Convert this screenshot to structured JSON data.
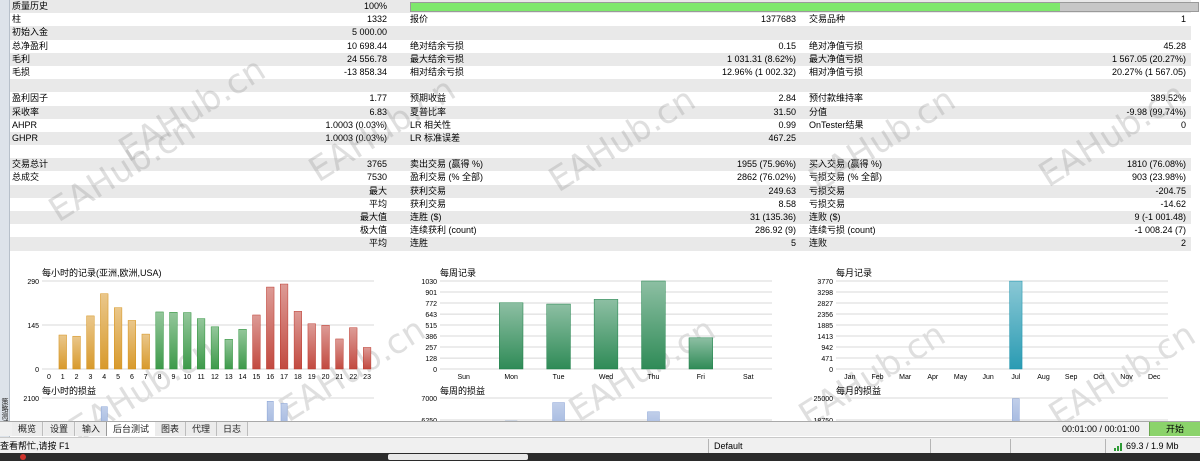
{
  "report": {
    "rows": [
      {
        "shade": true,
        "l1": "质量历史",
        "v1": "100%",
        "l2": "",
        "v2": "",
        "l3": "",
        "v3": ""
      },
      {
        "shade": false,
        "l1": "柱",
        "v1": "1332",
        "l2": "报价",
        "v2": "1377683",
        "l3": "交易品种",
        "v3": "1"
      },
      {
        "shade": true,
        "l1": "初始入金",
        "v1": "5 000.00",
        "l2": "",
        "v2": "",
        "l3": "",
        "v3": ""
      },
      {
        "shade": false,
        "l1": "总净盈利",
        "v1": "10 698.44",
        "l2": "绝对结余亏损",
        "v2": "0.15",
        "l3": "绝对净值亏损",
        "v3": "45.28"
      },
      {
        "shade": true,
        "l1": "毛利",
        "v1": "24 556.78",
        "l2": "最大结余亏损",
        "v2": "1 031.31 (8.62%)",
        "l3": "最大净值亏损",
        "v3": "1 567.05 (20.27%)"
      },
      {
        "shade": false,
        "l1": "毛损",
        "v1": "-13 858.34",
        "l2": "相对结余亏损",
        "v2": "12.96% (1 002.32)",
        "l3": "相对净值亏损",
        "v3": "20.27% (1 567.05)"
      },
      {
        "shade": true,
        "l1": "",
        "v1": "",
        "l2": "",
        "v2": "",
        "l3": "",
        "v3": ""
      },
      {
        "shade": false,
        "l1": "盈利因子",
        "v1": "1.77",
        "l2": "预期收益",
        "v2": "2.84",
        "l3": "预付款维持率",
        "v3": "389.52%"
      },
      {
        "shade": true,
        "l1": "采收率",
        "v1": "6.83",
        "l2": "夏普比率",
        "v2": "31.50",
        "l3": "分值",
        "v3": "-9.98 (99.74%)"
      },
      {
        "shade": false,
        "l1": "AHPR",
        "v1": "1.0003 (0.03%)",
        "l2": "LR 相关性",
        "v2": "0.99",
        "l3": "OnTester结果",
        "v3": "0"
      },
      {
        "shade": true,
        "l1": "GHPR",
        "v1": "1.0003 (0.03%)",
        "l2": "LR 标准误差",
        "v2": "467.25",
        "l3": "",
        "v3": ""
      },
      {
        "shade": false,
        "l1": "",
        "v1": "",
        "l2": "",
        "v2": "",
        "l3": "",
        "v3": ""
      },
      {
        "shade": true,
        "l1": "交易总计",
        "v1": "3765",
        "l2": "卖出交易 (赢得 %)",
        "v2": "1955 (75.96%)",
        "l3": "买入交易 (赢得 %)",
        "v3": "1810 (76.08%)"
      },
      {
        "shade": false,
        "l1": "总成交",
        "v1": "7530",
        "l2": "盈利交易 (% 全部)",
        "v2": "2862 (76.02%)",
        "l3": "亏损交易 (% 全部)",
        "v3": "903 (23.98%)"
      },
      {
        "shade": true,
        "l1": "",
        "v1": "最大",
        "l2": "获利交易",
        "v2": "249.63",
        "l3": "亏损交易",
        "v3": "-204.75"
      },
      {
        "shade": false,
        "l1": "",
        "v1": "平均",
        "l2": "获利交易",
        "v2": "8.58",
        "l3": "亏损交易",
        "v3": "-14.62"
      },
      {
        "shade": true,
        "l1": "",
        "v1": "最大值",
        "l2": "连胜 ($)",
        "v2": "31 (135.36)",
        "l3": "连败 ($)",
        "v3": "9 (-1 001.48)"
      },
      {
        "shade": false,
        "l1": "",
        "v1": "极大值",
        "l2": "连续获利 (count)",
        "v2": "286.92 (9)",
        "l3": "连续亏损 (count)",
        "v3": "-1 008.24 (7)"
      },
      {
        "shade": true,
        "l1": "",
        "v1": "平均",
        "l2": "连胜",
        "v2": "5",
        "l3": "连败",
        "v3": "2"
      },
      {
        "shade": false,
        "l1": "",
        "v1": "",
        "l2": "",
        "v2": "",
        "l3": "",
        "v3": ""
      }
    ],
    "quality_fill_fraction": 0.825
  },
  "chart_data": [
    {
      "type": "bar",
      "title": "每小时的记录(亚洲,欧洲,USA)",
      "categories": [
        "0",
        "1",
        "2",
        "3",
        "4",
        "5",
        "6",
        "7",
        "8",
        "9",
        "10",
        "11",
        "12",
        "13",
        "14",
        "15",
        "16",
        "17",
        "18",
        "19",
        "20",
        "21",
        "22",
        "23"
      ],
      "values": [
        0,
        112,
        108,
        175,
        248,
        202,
        160,
        115,
        188,
        187,
        186,
        166,
        139,
        98,
        131,
        178,
        270,
        280,
        190,
        149,
        144,
        99,
        136,
        71
      ],
      "bar_colors": [
        "#d89a2c",
        "#d89a2c",
        "#d89a2c",
        "#d89a2c",
        "#d89a2c",
        "#d89a2c",
        "#d89a2c",
        "#d89a2c",
        "#3d9a4a",
        "#3d9a4a",
        "#3d9a4a",
        "#3d9a4a",
        "#3d9a4a",
        "#3d9a4a",
        "#3d9a4a",
        "#c24a40",
        "#c24a40",
        "#c24a40",
        "#c24a40",
        "#c24a40",
        "#c24a40",
        "#c24a40",
        "#c24a40",
        "#c24a40"
      ],
      "ytick_labels": [
        "290",
        "145",
        "0"
      ],
      "ylim": [
        0,
        290
      ]
    },
    {
      "type": "bar",
      "title": "每周记录",
      "categories": [
        "Sun",
        "Mon",
        "Tue",
        "Wed",
        "Thu",
        "Fri",
        "Sat"
      ],
      "values": [
        0,
        775,
        760,
        815,
        1030,
        365,
        0
      ],
      "bar_color": "#2f8b57",
      "ytick_labels": [
        "1030",
        "901",
        "772",
        "643",
        "515",
        "386",
        "257",
        "128",
        "0"
      ],
      "ylim": [
        0,
        1030
      ]
    },
    {
      "type": "bar",
      "title": "每月记录",
      "categories": [
        "Jan",
        "Feb",
        "Mar",
        "Apr",
        "May",
        "Jun",
        "Jul",
        "Aug",
        "Sep",
        "Oct",
        "Nov",
        "Dec"
      ],
      "values": [
        0,
        0,
        0,
        0,
        0,
        0,
        3765,
        0,
        0,
        0,
        0,
        0
      ],
      "bar_color": "#2a9bb3",
      "ytick_labels": [
        "3770",
        "3298",
        "2827",
        "2356",
        "1885",
        "1413",
        "942",
        "471",
        "0"
      ],
      "ylim": [
        0,
        3770
      ]
    },
    {
      "type": "bar",
      "title": "每小时的损益",
      "categories": [
        "0",
        "1",
        "2",
        "3",
        "4",
        "5",
        "6",
        "7",
        "8",
        "9",
        "10",
        "11",
        "12",
        "13",
        "14",
        "15",
        "16",
        "17",
        "18",
        "19",
        "20",
        "21",
        "22",
        "23"
      ],
      "values": [
        0,
        0,
        0,
        0,
        1700,
        0,
        0,
        0,
        0,
        0,
        0,
        0,
        0,
        0,
        0,
        0,
        1950,
        1850,
        0,
        0,
        0,
        0,
        0,
        0
      ],
      "bar_color": "#8fa8d8",
      "ytick_labels": [
        "2100"
      ],
      "ylim": [
        0,
        2100
      ]
    },
    {
      "type": "bar",
      "title": "每周的损益",
      "categories": [
        "Sun",
        "Mon",
        "Tue",
        "Wed",
        "Thu",
        "Fri",
        "Sat"
      ],
      "values": [
        0,
        6500,
        6900,
        0,
        6700,
        0,
        0
      ],
      "bar_color": "#8fa8d8",
      "ytick_labels": [
        "7000",
        "6250"
      ],
      "ylim": [
        6000,
        7000
      ]
    },
    {
      "type": "bar",
      "title": "每月的损益",
      "categories": [
        "Jan",
        "Feb",
        "Mar",
        "Apr",
        "May",
        "Jun",
        "Jul",
        "Aug",
        "Sep",
        "Oct",
        "Nov",
        "Dec"
      ],
      "values": [
        0,
        0,
        0,
        0,
        0,
        0,
        24800,
        0,
        0,
        0,
        0,
        0
      ],
      "bar_color": "#8fa8d8",
      "ytick_labels": [
        "25000",
        "18750"
      ],
      "ylim": [
        12000,
        25000
      ]
    }
  ],
  "watermark_text": "EAHub.cn",
  "left_strip_label": "策略测试",
  "tabs": [
    {
      "label": "概览",
      "active": false
    },
    {
      "label": "设置",
      "active": false
    },
    {
      "label": "输入",
      "active": false
    },
    {
      "label": "后台测试",
      "active": true
    },
    {
      "label": "图表",
      "active": false
    },
    {
      "label": "代理",
      "active": false
    },
    {
      "label": "日志",
      "active": false
    }
  ],
  "time_readout": "00:01:00 / 00:01:00",
  "start_button_label": "开始",
  "status": {
    "help_text": "查看帮忙,请按 F1",
    "profile": "Default",
    "network": "69.3 / 1.9 Mb"
  }
}
